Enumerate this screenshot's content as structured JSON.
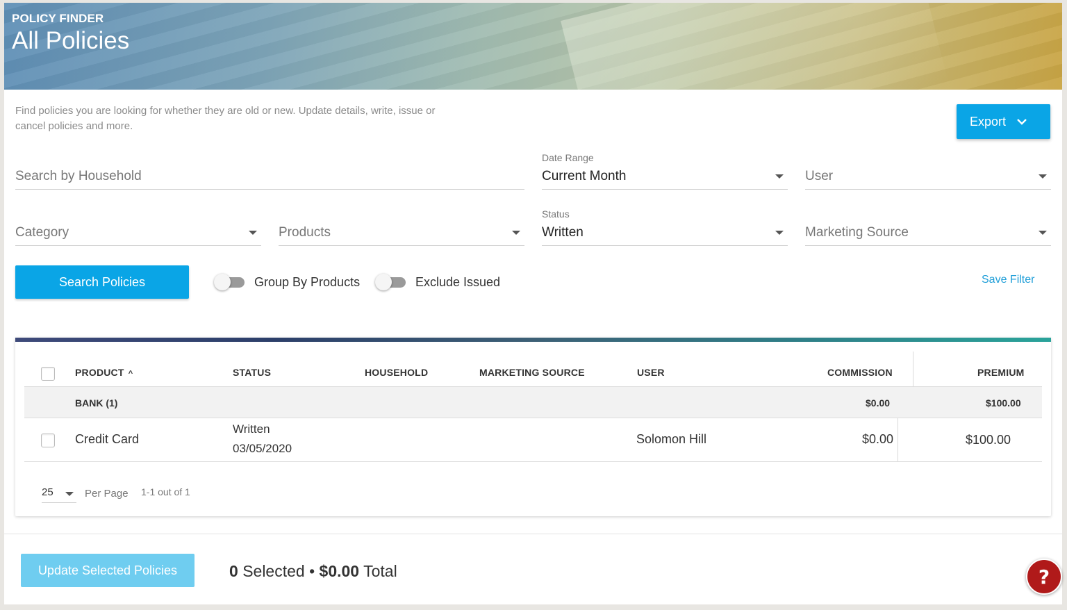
{
  "header": {
    "kicker": "POLICY FINDER",
    "title": "All Policies"
  },
  "description": "Find policies you are looking for whether they are old or new. Update details, write, issue or cancel policies and more.",
  "export_button": {
    "label": "Export",
    "icon": "chevron-down-icon"
  },
  "filters": {
    "search_household": {
      "placeholder": "Search by Household"
    },
    "date_range": {
      "label": "Date Range",
      "value": "Current Month"
    },
    "user": {
      "placeholder": "User"
    },
    "category": {
      "placeholder": "Category"
    },
    "products": {
      "placeholder": "Products"
    },
    "status": {
      "label": "Status",
      "value": "Written"
    },
    "marketing_source": {
      "placeholder": "Marketing Source"
    }
  },
  "actions": {
    "search_label": "Search Policies",
    "group_by_products": "Group By Products",
    "exclude_issued": "Exclude Issued",
    "save_filter": "Save Filter"
  },
  "table": {
    "columns": [
      "PRODUCT",
      "STATUS",
      "HOUSEHOLD",
      "MARKETING SOURCE",
      "USER",
      "COMMISSION",
      "PREMIUM"
    ],
    "sort_indicator": "^",
    "group": {
      "label": "BANK (1)",
      "commission": "$0.00",
      "premium": "$100.00"
    },
    "rows": [
      {
        "product": "Credit Card",
        "status": "Written",
        "date": "03/05/2020",
        "household": "",
        "marketing_source": "",
        "user": "Solomon Hill",
        "commission": "$0.00",
        "premium": "$100.00"
      }
    ]
  },
  "pagination": {
    "per_page_value": "25",
    "per_page_label": "Per Page",
    "range": "1-1 out of 1"
  },
  "footer": {
    "update_label": "Update Selected Policies",
    "selected_count": "0",
    "selected_label": "Selected",
    "separator": "•",
    "total_amount": "$0.00",
    "total_label": "Total"
  },
  "help": {
    "label": "?"
  },
  "colors": {
    "primary": "#0aa5e6",
    "primary_disabled": "#6fcdf0",
    "help": "#b01a1a",
    "link": "#1f9ed8"
  }
}
